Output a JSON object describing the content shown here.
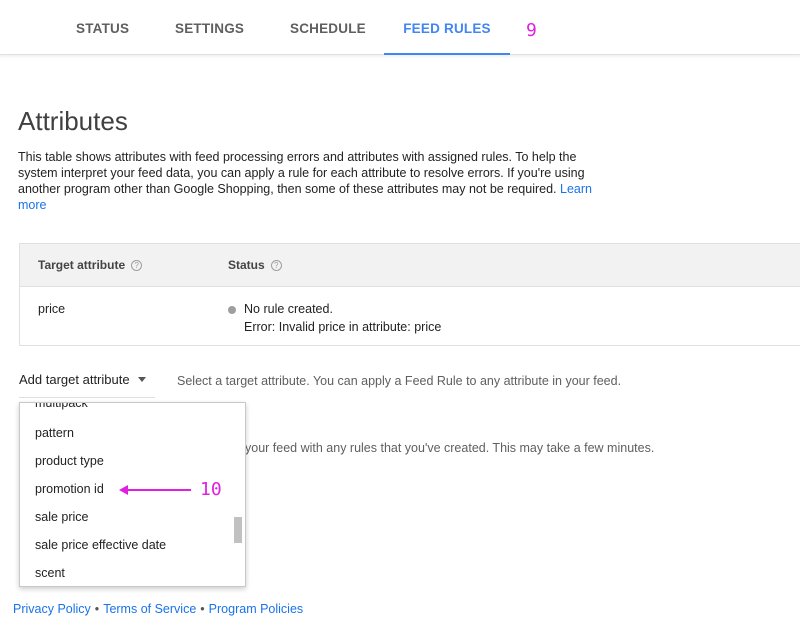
{
  "tabs": [
    {
      "label": "STATUS"
    },
    {
      "label": "SETTINGS"
    },
    {
      "label": "SCHEDULE"
    },
    {
      "label": "FEED RULES"
    }
  ],
  "annotations": {
    "tab_marker": "9",
    "arrow_marker": "10"
  },
  "section": {
    "title": "Attributes",
    "description": "This table shows attributes with feed processing errors and attributes with assigned rules. To help the system interpret your feed data, you can apply a rule for each attribute to resolve errors. If you're using another program other than Google Shopping, then some of these attributes may not be required.",
    "learn_more": "Learn more"
  },
  "table": {
    "headers": [
      "Target attribute",
      "Status"
    ],
    "rows": [
      {
        "attribute": "price",
        "status_line1": "No rule created.",
        "status_line2": "Error: Invalid price in attribute: price"
      }
    ]
  },
  "add_attribute": {
    "label": "Add target attribute",
    "hint": "Select a target attribute. You can apply a Feed Rule to any attribute in your feed."
  },
  "partially_hidden_text": "your feed with any rules that you've created. This may take a few minutes.",
  "dropdown": {
    "items": [
      "multipack",
      "pattern",
      "product type",
      "promotion id",
      "sale price",
      "sale price effective date",
      "scent"
    ]
  },
  "footer": {
    "links": [
      "Privacy Policy",
      "Terms of Service",
      "Program Policies"
    ]
  },
  "colors": {
    "accent": "#4285f4",
    "annotation": "#e020e0",
    "link": "#1a73e8"
  }
}
